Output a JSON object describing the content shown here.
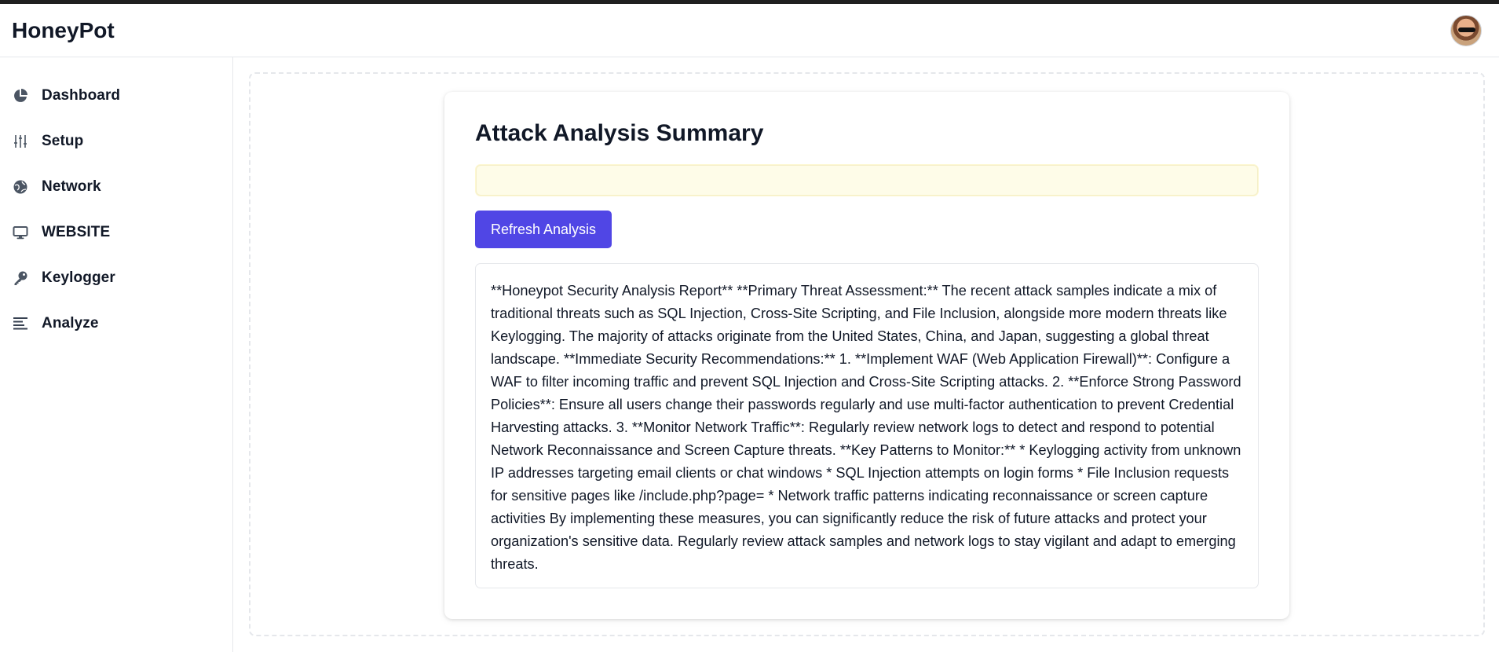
{
  "app": {
    "title": "HoneyPot"
  },
  "sidebar": {
    "items": [
      {
        "label": "Dashboard",
        "icon": "pie-chart-icon"
      },
      {
        "label": "Setup",
        "icon": "sliders-icon"
      },
      {
        "label": "Network",
        "icon": "globe-icon"
      },
      {
        "label": "WEBSITE",
        "icon": "monitor-icon"
      },
      {
        "label": "Keylogger",
        "icon": "key-icon"
      },
      {
        "label": "Analyze",
        "icon": "align-left-icon"
      }
    ]
  },
  "main": {
    "title": "Attack Analysis Summary",
    "notice": "",
    "refresh_label": "Refresh Analysis",
    "report": "**Honeypot Security Analysis Report** **Primary Threat Assessment:** The recent attack samples indicate a mix of traditional threats such as SQL Injection, Cross-Site Scripting, and File Inclusion, alongside more modern threats like Keylogging. The majority of attacks originate from the United States, China, and Japan, suggesting a global threat landscape. **Immediate Security Recommendations:** 1. **Implement WAF (Web Application Firewall)**: Configure a WAF to filter incoming traffic and prevent SQL Injection and Cross-Site Scripting attacks. 2. **Enforce Strong Password Policies**: Ensure all users change their passwords regularly and use multi-factor authentication to prevent Credential Harvesting attacks. 3. **Monitor Network Traffic**: Regularly review network logs to detect and respond to potential Network Reconnaissance and Screen Capture threats. **Key Patterns to Monitor:** * Keylogging activity from unknown IP addresses targeting email clients or chat windows * SQL Injection attempts on login forms * File Inclusion requests for sensitive pages like /include.php?page= * Network traffic patterns indicating reconnaissance or screen capture activities By implementing these measures, you can significantly reduce the risk of future attacks and protect your organization's sensitive data. Regularly review attack samples and network logs to stay vigilant and adapt to emerging threats."
  },
  "colors": {
    "accent": "#5046e5",
    "notice_bg": "#fefce8",
    "icon": "#4b5563"
  }
}
